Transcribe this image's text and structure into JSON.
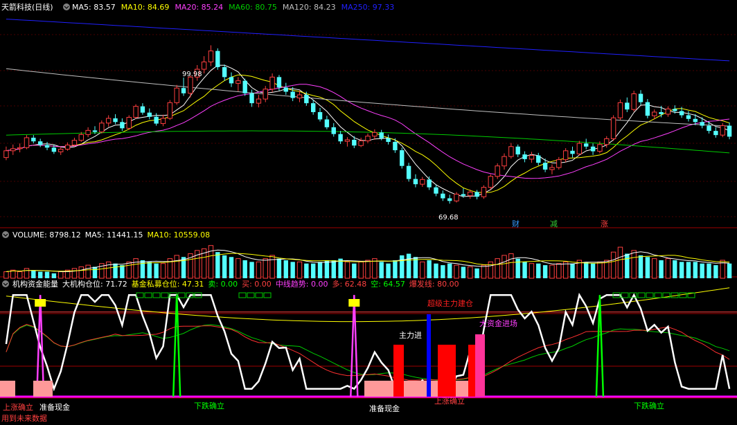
{
  "colors": {
    "background": "#000000",
    "grid": "#7a0000",
    "up": "#ff4040",
    "down": "#54ffff",
    "ma5": "#ffffff",
    "ma10": "#ffff00",
    "ma20": "#ff40ff",
    "ma60": "#00cc00",
    "ma120": "#c0c0c0",
    "ma250": "#2020ff"
  },
  "price_panel": {
    "title": "天箭科技(日线)",
    "ma_legend": [
      {
        "label": "MA5: 83.57",
        "color": "#ffffff"
      },
      {
        "label": "MA10: 84.69",
        "color": "#ffff00"
      },
      {
        "label": "MA20: 85.24",
        "color": "#ff40ff"
      },
      {
        "label": "MA60: 80.75",
        "color": "#00cc00"
      },
      {
        "label": "MA120: 84.23",
        "color": "#c0c0c0"
      },
      {
        "label": "MA250: 97.33",
        "color": "#2020ff"
      }
    ],
    "high_label": "99.98",
    "low_label": "69.68",
    "markers": [
      {
        "text": "财",
        "color": "#3399ff"
      },
      {
        "text": "减",
        "color": "#33cc33"
      },
      {
        "text": "涨",
        "color": "#ff4040"
      }
    ]
  },
  "volume_panel": {
    "legend": [
      {
        "label": "VOLUME: 8798.12",
        "color": "#ffffff"
      },
      {
        "label": "MA5: 11441.15",
        "color": "#ffffff"
      },
      {
        "label": "MA10: 10559.08",
        "color": "#ffff00"
      }
    ]
  },
  "indicator_panel": {
    "legend": [
      {
        "label": "机构资金能量",
        "color": "#ffffff"
      },
      {
        "label": "大机构仓位: 71.72",
        "color": "#ffffff"
      },
      {
        "label": "基金私募仓位: 47.31",
        "color": "#ffff00"
      },
      {
        "label": "卖: 0.00",
        "color": "#00ff00"
      },
      {
        "label": "买: 0.00",
        "color": "#ff4040"
      },
      {
        "label": "中线趋势: 0.00",
        "color": "#ff40ff"
      },
      {
        "label": "多: 62.48",
        "color": "#ff4040"
      },
      {
        "label": "空: 64.57",
        "color": "#00ff00"
      },
      {
        "label": "爆发线: 80.00",
        "color": "#ff4040"
      }
    ],
    "annotations": [
      {
        "text": "上涨确立",
        "color": "#ff4040"
      },
      {
        "text": "准备现金",
        "color": "#ffffff"
      },
      {
        "text": "下跌确立",
        "color": "#00ff00"
      },
      {
        "text": "准备现金",
        "color": "#ffffff"
      },
      {
        "text": "上涨确立",
        "color": "#ff4040"
      },
      {
        "text": "下跌确立",
        "color": "#00ff00"
      },
      {
        "text": "超级主力建仓",
        "color": "#ff2020"
      },
      {
        "text": "大资金进场",
        "color": "#ff40ff"
      },
      {
        "text": "主力进",
        "color": "#ffffff"
      }
    ],
    "footer": "用到未来数据"
  },
  "chart_data": {
    "type": "candlestick",
    "title": "天箭科技(日线)",
    "note_values": {
      "high": 99.98,
      "low": 69.68
    },
    "ylim": [
      66,
      106
    ],
    "ohlc": [
      [
        78.5,
        80.6,
        78.0,
        79.8
      ],
      [
        79.8,
        81.0,
        79.0,
        80.2
      ],
      [
        80.2,
        81.2,
        79.5,
        80.4
      ],
      [
        80.4,
        82.8,
        80.1,
        82.3
      ],
      [
        82.3,
        82.8,
        81.2,
        81.6
      ],
      [
        81.6,
        82.1,
        80.5,
        80.9
      ],
      [
        80.9,
        81.5,
        79.9,
        80.4
      ],
      [
        80.4,
        80.9,
        79.2,
        79.6
      ],
      [
        79.6,
        80.4,
        79.0,
        80.1
      ],
      [
        80.1,
        81.4,
        79.8,
        80.9
      ],
      [
        80.9,
        82.3,
        80.6,
        81.8
      ],
      [
        81.8,
        83.4,
        81.5,
        82.9
      ],
      [
        82.9,
        84.3,
        82.4,
        83.7
      ],
      [
        83.7,
        84.5,
        83.0,
        83.4
      ],
      [
        83.4,
        85.6,
        83.1,
        85.1
      ],
      [
        85.1,
        86.6,
        84.4,
        86.0
      ],
      [
        86.0,
        86.8,
        84.9,
        85.3
      ],
      [
        85.3,
        86.0,
        83.6,
        84.1
      ],
      [
        84.1,
        86.6,
        83.8,
        86.2
      ],
      [
        86.2,
        88.7,
        85.9,
        88.3
      ],
      [
        88.3,
        88.9,
        86.7,
        87.1
      ],
      [
        87.1,
        87.9,
        85.8,
        86.3
      ],
      [
        86.3,
        87.0,
        84.6,
        85.0
      ],
      [
        85.0,
        86.7,
        84.5,
        86.0
      ],
      [
        86.0,
        89.5,
        85.7,
        89.0
      ],
      [
        89.0,
        92.4,
        88.6,
        91.8
      ],
      [
        91.8,
        93.8,
        90.3,
        90.8
      ],
      [
        90.8,
        94.2,
        90.0,
        93.9
      ],
      [
        93.9,
        96.2,
        93.2,
        95.4
      ],
      [
        95.4,
        97.9,
        94.6,
        96.8
      ],
      [
        96.8,
        99.98,
        96.0,
        98.9
      ],
      [
        98.9,
        99.4,
        95.3,
        95.8
      ],
      [
        95.8,
        96.3,
        93.2,
        93.9
      ],
      [
        93.9,
        94.8,
        92.0,
        92.7
      ],
      [
        92.7,
        93.9,
        91.2,
        93.2
      ],
      [
        93.2,
        93.6,
        90.3,
        90.8
      ],
      [
        90.8,
        91.5,
        88.2,
        88.9
      ],
      [
        88.9,
        90.5,
        88.1,
        89.7
      ],
      [
        89.7,
        92.2,
        89.1,
        91.6
      ],
      [
        91.6,
        94.6,
        91.0,
        93.9
      ],
      [
        93.9,
        94.3,
        91.3,
        91.9
      ],
      [
        91.9,
        92.8,
        90.5,
        91.1
      ],
      [
        91.1,
        92.0,
        89.3,
        89.9
      ],
      [
        89.9,
        91.3,
        89.1,
        90.5
      ],
      [
        90.5,
        91.1,
        88.4,
        88.9
      ],
      [
        88.9,
        89.5,
        86.7,
        87.2
      ],
      [
        87.2,
        88.0,
        85.4,
        85.8
      ],
      [
        85.8,
        86.5,
        83.9,
        84.3
      ],
      [
        84.3,
        85.1,
        82.5,
        83.0
      ],
      [
        83.0,
        83.6,
        81.1,
        81.6
      ],
      [
        81.6,
        82.4,
        80.6,
        81.9
      ],
      [
        81.9,
        82.6,
        80.3,
        80.8
      ],
      [
        80.8,
        82.3,
        80.5,
        81.7
      ],
      [
        81.7,
        83.1,
        81.3,
        82.6
      ],
      [
        82.6,
        83.9,
        81.9,
        83.3
      ],
      [
        83.3,
        83.8,
        81.8,
        82.2
      ],
      [
        82.2,
        82.9,
        81.0,
        81.5
      ],
      [
        81.5,
        82.2,
        79.4,
        79.9
      ],
      [
        79.9,
        80.4,
        76.4,
        76.9
      ],
      [
        76.9,
        77.5,
        73.9,
        74.4
      ],
      [
        74.4,
        75.3,
        72.8,
        73.4
      ],
      [
        73.4,
        74.8,
        72.9,
        74.3
      ],
      [
        74.3,
        74.9,
        72.3,
        72.8
      ],
      [
        72.8,
        73.3,
        71.1,
        71.6
      ],
      [
        71.6,
        72.2,
        70.2,
        70.7
      ],
      [
        70.7,
        71.4,
        69.68,
        70.2
      ],
      [
        70.2,
        71.9,
        69.9,
        71.5
      ],
      [
        71.5,
        72.6,
        70.8,
        71.2
      ],
      [
        71.2,
        72.4,
        70.6,
        71.9
      ],
      [
        71.9,
        72.3,
        70.5,
        71.0
      ],
      [
        71.0,
        73.2,
        70.6,
        72.8
      ],
      [
        72.8,
        75.3,
        72.4,
        74.9
      ],
      [
        74.9,
        77.4,
        74.4,
        76.9
      ],
      [
        76.9,
        79.3,
        76.2,
        78.7
      ],
      [
        78.7,
        81.3,
        78.3,
        80.6
      ],
      [
        80.6,
        81.0,
        78.6,
        79.1
      ],
      [
        79.1,
        79.7,
        77.6,
        78.2
      ],
      [
        78.2,
        79.6,
        77.5,
        78.9
      ],
      [
        78.9,
        79.4,
        77.0,
        77.5
      ],
      [
        77.5,
        78.3,
        75.7,
        76.2
      ],
      [
        76.2,
        77.2,
        75.3,
        76.6
      ],
      [
        76.6,
        78.6,
        76.2,
        78.1
      ],
      [
        78.1,
        80.3,
        77.6,
        79.8
      ],
      [
        79.8,
        80.6,
        78.5,
        79.2
      ],
      [
        79.2,
        81.7,
        78.9,
        81.2
      ],
      [
        81.2,
        82.1,
        80.1,
        80.6
      ],
      [
        80.6,
        81.2,
        79.0,
        79.7
      ],
      [
        79.7,
        81.6,
        79.3,
        81.0
      ],
      [
        81.0,
        82.6,
        80.4,
        82.1
      ],
      [
        82.1,
        86.6,
        81.7,
        86.1
      ],
      [
        86.1,
        89.6,
        85.7,
        89.0
      ],
      [
        89.0,
        90.0,
        87.2,
        87.7
      ],
      [
        87.7,
        91.3,
        87.3,
        90.7
      ],
      [
        90.7,
        91.4,
        88.6,
        89.1
      ],
      [
        89.1,
        89.7,
        86.0,
        86.5
      ],
      [
        86.5,
        87.7,
        85.8,
        87.2
      ],
      [
        87.2,
        88.4,
        86.2,
        86.8
      ],
      [
        86.8,
        88.3,
        86.3,
        87.8
      ],
      [
        87.8,
        88.5,
        86.9,
        87.4
      ],
      [
        87.4,
        88.2,
        86.1,
        86.6
      ],
      [
        86.6,
        87.4,
        85.4,
        85.9
      ],
      [
        85.9,
        86.8,
        84.7,
        85.3
      ],
      [
        85.3,
        86.2,
        84.1,
        84.6
      ],
      [
        84.6,
        85.4,
        83.1,
        83.6
      ],
      [
        83.6,
        84.3,
        82.3,
        82.8
      ],
      [
        82.8,
        85.1,
        82.4,
        84.6
      ],
      [
        84.6,
        85.2,
        82.0,
        82.5
      ]
    ],
    "volume": [
      4,
      5,
      4,
      6,
      5,
      4,
      4,
      3,
      4,
      5,
      6,
      7,
      8,
      7,
      9,
      10,
      9,
      8,
      10,
      12,
      11,
      10,
      9,
      9,
      12,
      14,
      13,
      15,
      17,
      18,
      20,
      16,
      14,
      13,
      12,
      11,
      10,
      10,
      12,
      14,
      12,
      11,
      10,
      10,
      9,
      9,
      10,
      11,
      11,
      12,
      10,
      9,
      10,
      11,
      12,
      10,
      9,
      11,
      14,
      15,
      13,
      10,
      11,
      9,
      8,
      9,
      8,
      7,
      7,
      6,
      8,
      10,
      12,
      14,
      15,
      12,
      10,
      9,
      9,
      8,
      8,
      9,
      10,
      9,
      11,
      10,
      9,
      10,
      11,
      16,
      19,
      15,
      17,
      14,
      13,
      12,
      11,
      12,
      11,
      10,
      10,
      10,
      9,
      9,
      8,
      11,
      9
    ],
    "volume_ma": {
      "MA5": 11441.15,
      "MA10": 10559.08,
      "VOLUME": 8798.12
    },
    "ma_values": {
      "MA5": 83.57,
      "MA10": 84.69,
      "MA20": 85.24,
      "MA60": 80.75,
      "MA120": 84.23,
      "MA250": 97.33
    },
    "indicator": {
      "大机构仓位": 71.72,
      "基金私募仓位": 47.31,
      "卖": 0.0,
      "买": 0.0,
      "中线趋势": 0.0,
      "多": 62.48,
      "空": 64.57,
      "爆发线": 80.0
    }
  }
}
